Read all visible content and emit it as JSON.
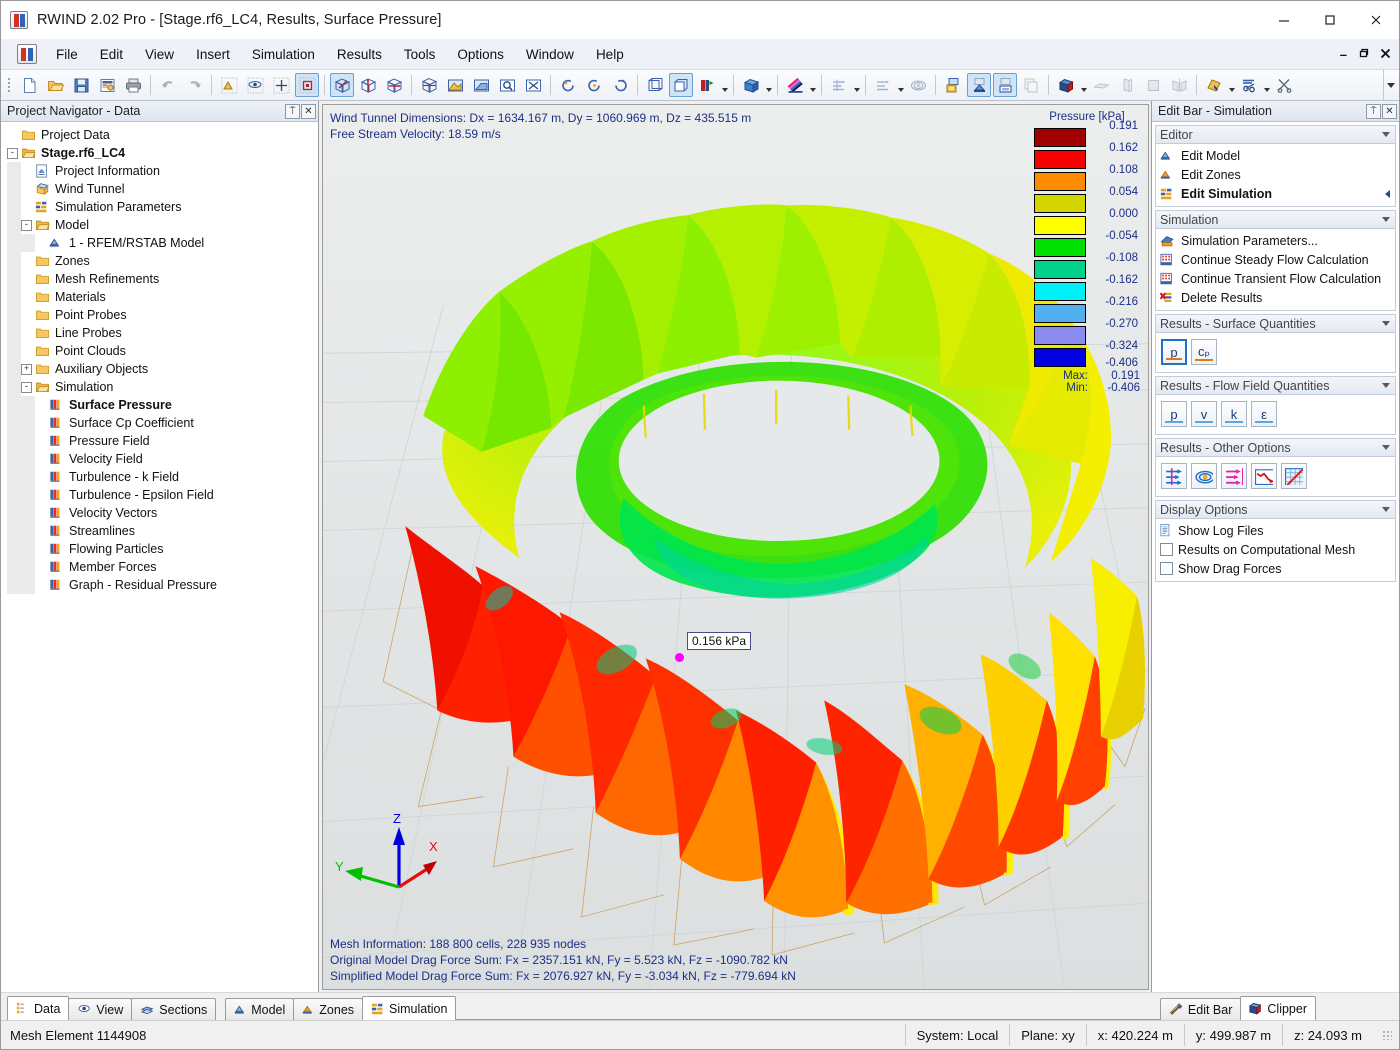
{
  "window": {
    "title": "RWIND 2.02 Pro - [Stage.rf6_LC4, Results, Surface Pressure]",
    "minimize": "—",
    "maximize": "□",
    "close": "✕",
    "mdi_minimize": "–",
    "mdi_restore": "❐",
    "mdi_close": "✕"
  },
  "menu": {
    "items": [
      {
        "label": "File"
      },
      {
        "label": "Edit"
      },
      {
        "label": "View"
      },
      {
        "label": "Insert"
      },
      {
        "label": "Simulation"
      },
      {
        "label": "Results"
      },
      {
        "label": "Tools"
      },
      {
        "label": "Options"
      },
      {
        "label": "Window"
      },
      {
        "label": "Help"
      }
    ]
  },
  "toolbar": {
    "buttons": [
      {
        "name": "new-file-icon",
        "active": false
      },
      {
        "name": "open-file-icon",
        "active": false
      },
      {
        "name": "save-icon",
        "active": false
      },
      {
        "name": "printout-report-icon",
        "active": false
      },
      {
        "name": "print-icon",
        "active": false
      },
      {
        "sep": true
      },
      {
        "name": "undo-icon",
        "active": false
      },
      {
        "name": "redo-icon",
        "active": false
      },
      {
        "sep": true
      },
      {
        "name": "snap-point-icon",
        "active": false
      },
      {
        "name": "object-snap-icon",
        "active": false
      },
      {
        "name": "grid-snap-icon",
        "active": false
      },
      {
        "name": "selection-box-icon",
        "active": true
      },
      {
        "sep": true
      },
      {
        "name": "view-iso-icon",
        "active": true
      },
      {
        "name": "view-rotate-icon",
        "active": false
      },
      {
        "name": "view-axes-icon",
        "active": false
      },
      {
        "sep": true
      },
      {
        "name": "view-cube-icon",
        "active": false
      },
      {
        "name": "render-shade-icon",
        "active": false
      },
      {
        "name": "zoom-window-icon",
        "active": false
      },
      {
        "name": "zoom-magnifier-icon",
        "active": false
      },
      {
        "name": "zoom-fit-icon",
        "active": false
      },
      {
        "sep": true
      },
      {
        "name": "rotate-left-icon",
        "active": false
      },
      {
        "name": "rotate-center-icon",
        "active": false
      },
      {
        "name": "rotate-right-icon",
        "active": false
      },
      {
        "sep": true
      },
      {
        "name": "wireframe-icon",
        "active": false
      },
      {
        "name": "solid-view-icon",
        "active": true
      },
      {
        "name": "move-axis-icon",
        "dropdown": true,
        "active": false
      },
      {
        "sep": true
      },
      {
        "name": "render-box-icon",
        "dropdown": true,
        "active": false
      },
      {
        "sep": true
      },
      {
        "name": "colors-icon",
        "dropdown": true,
        "active": false
      },
      {
        "sep": true
      },
      {
        "name": "flow-lines-icon",
        "dropdown": true,
        "active": false,
        "disabled": true
      },
      {
        "sep": true
      },
      {
        "name": "streamline-icon",
        "dropdown": true,
        "active": false,
        "disabled": true
      },
      {
        "name": "iso-surface-icon",
        "active": false,
        "disabled": true
      },
      {
        "sep": true
      },
      {
        "name": "zone-display-icon",
        "active": false
      },
      {
        "name": "model-display-icon",
        "active": true
      },
      {
        "name": "simulation-display-icon",
        "active": true
      },
      {
        "name": "copy-display-icon",
        "active": false,
        "disabled": true
      },
      {
        "sep": true
      },
      {
        "name": "clipper-box-icon",
        "dropdown": true,
        "active": false
      },
      {
        "name": "clip-plane-xy-icon",
        "active": false,
        "disabled": true
      },
      {
        "name": "clip-plane-yz-icon",
        "active": false,
        "disabled": true
      },
      {
        "name": "clip-plane-fill-icon",
        "active": false,
        "disabled": true
      },
      {
        "name": "clip-plane-mirror-icon",
        "active": false,
        "disabled": true
      },
      {
        "sep": true
      },
      {
        "name": "measure-icon",
        "dropdown": true,
        "active": false
      },
      {
        "name": "settings-tools-icon",
        "dropdown": true,
        "active": false
      },
      {
        "name": "cut-tools-icon",
        "active": false
      }
    ]
  },
  "navigator": {
    "title": "Project Navigator - Data",
    "pin_glyph": "⍑",
    "close_glyph": "✕",
    "tree": [
      {
        "label": "Project Data",
        "depth": 0,
        "expander": "",
        "icon": "folder",
        "bold": false
      },
      {
        "label": "Stage.rf6_LC4",
        "depth": 0,
        "expander": "-",
        "icon": "folder-open",
        "bold": true
      },
      {
        "label": "Project Information",
        "depth": 1,
        "expander": "",
        "icon": "project-info",
        "bold": false
      },
      {
        "label": "Wind Tunnel",
        "depth": 1,
        "expander": "",
        "icon": "wind-tunnel",
        "bold": false
      },
      {
        "label": "Simulation Parameters",
        "depth": 1,
        "expander": "",
        "icon": "sim-params",
        "bold": false
      },
      {
        "label": "Model",
        "depth": 1,
        "expander": "-",
        "icon": "folder-open",
        "bold": false
      },
      {
        "label": "1 - RFEM/RSTAB Model",
        "depth": 2,
        "expander": "",
        "icon": "model-node",
        "bold": false
      },
      {
        "label": "Zones",
        "depth": 1,
        "expander": "",
        "icon": "folder",
        "bold": false
      },
      {
        "label": "Mesh Refinements",
        "depth": 1,
        "expander": "",
        "icon": "folder",
        "bold": false
      },
      {
        "label": "Materials",
        "depth": 1,
        "expander": "",
        "icon": "folder",
        "bold": false
      },
      {
        "label": "Point Probes",
        "depth": 1,
        "expander": "",
        "icon": "folder",
        "bold": false
      },
      {
        "label": "Line Probes",
        "depth": 1,
        "expander": "",
        "icon": "folder",
        "bold": false
      },
      {
        "label": "Point Clouds",
        "depth": 1,
        "expander": "",
        "icon": "folder",
        "bold": false
      },
      {
        "label": "Auxiliary Objects",
        "depth": 1,
        "expander": "+",
        "icon": "folder",
        "bold": false
      },
      {
        "label": "Simulation",
        "depth": 1,
        "expander": "-",
        "icon": "folder-open",
        "bold": false
      },
      {
        "label": "Surface Pressure",
        "depth": 2,
        "expander": "",
        "icon": "result",
        "bold": true
      },
      {
        "label": "Surface Cp Coefficient",
        "depth": 2,
        "expander": "",
        "icon": "result",
        "bold": false
      },
      {
        "label": "Pressure Field",
        "depth": 2,
        "expander": "",
        "icon": "result",
        "bold": false
      },
      {
        "label": "Velocity Field",
        "depth": 2,
        "expander": "",
        "icon": "result",
        "bold": false
      },
      {
        "label": "Turbulence - k Field",
        "depth": 2,
        "expander": "",
        "icon": "result",
        "bold": false
      },
      {
        "label": "Turbulence - Epsilon Field",
        "depth": 2,
        "expander": "",
        "icon": "result",
        "bold": false
      },
      {
        "label": "Velocity Vectors",
        "depth": 2,
        "expander": "",
        "icon": "result",
        "bold": false
      },
      {
        "label": "Streamlines",
        "depth": 2,
        "expander": "",
        "icon": "result",
        "bold": false
      },
      {
        "label": "Flowing Particles",
        "depth": 2,
        "expander": "",
        "icon": "result",
        "bold": false
      },
      {
        "label": "Member Forces",
        "depth": 2,
        "expander": "",
        "icon": "result",
        "bold": false
      },
      {
        "label": "Graph - Residual Pressure",
        "depth": 2,
        "expander": "",
        "icon": "result",
        "bold": false
      }
    ]
  },
  "viewport": {
    "header_line1": "Wind Tunnel Dimensions: Dx = 1634.167 m, Dy = 1060.969 m, Dz = 435.515 m",
    "header_line2": "Free Stream Velocity: 18.59 m/s",
    "footer_line1": "Mesh Information: 188 800 cells, 228 935 nodes",
    "footer_line2": "Original Model Drag Force Sum: Fx = 2357.151 kN, Fy = 5.523 kN, Fz = -1090.782 kN",
    "footer_line3": "Simplified Model Drag Force Sum: Fx = 2076.927 kN, Fy = -3.034 kN, Fz = -779.694 kN",
    "tooltip_value": "0.156 kPa",
    "axes": {
      "x": "X",
      "y": "Y",
      "z": "Z",
      "x_color": "#e01010",
      "y_color": "#00c000",
      "z_color": "#0000e0"
    }
  },
  "legend": {
    "title": "Pressure [kPa]",
    "max_label": "Max:",
    "min_label": "Min:",
    "max_value": "0.191",
    "min_value": "-0.406",
    "swatches": [
      {
        "color": "#a00000",
        "above": "0.191",
        "below": "0.162"
      },
      {
        "color": "#f80000",
        "above": "0.162",
        "below": "0.108"
      },
      {
        "color": "#ff8c00",
        "above": "0.108",
        "below": "0.054"
      },
      {
        "color": "#d4d400",
        "above": "0.054",
        "below": "0.000"
      },
      {
        "color": "#ffff00",
        "above": "0.000",
        "below": "-0.054"
      },
      {
        "color": "#00e000",
        "above": "-0.054",
        "below": "-0.108"
      },
      {
        "color": "#00d28c",
        "above": "-0.108",
        "below": "-0.162"
      },
      {
        "color": "#00f0f8",
        "above": "-0.162",
        "below": "-0.216"
      },
      {
        "color": "#52b0f0",
        "above": "-0.216",
        "below": "-0.270"
      },
      {
        "color": "#8c8cf0",
        "above": "-0.270",
        "below": "-0.324"
      },
      {
        "color": "#0000e0",
        "above": "-0.324",
        "below": "-0.406"
      }
    ],
    "values": [
      "0.191",
      "0.162",
      "0.108",
      "0.054",
      "0.000",
      "-0.054",
      "-0.108",
      "-0.162",
      "-0.216",
      "-0.270",
      "-0.324",
      "-0.406"
    ]
  },
  "editbar": {
    "title": "Edit Bar - Simulation",
    "pin_glyph": "⍑",
    "close_glyph": "✕",
    "sections": [
      {
        "title": "Editor",
        "type": "list",
        "items": [
          {
            "label": "Edit Model",
            "icon": "edit-model",
            "bold": false,
            "arrow": false
          },
          {
            "label": "Edit Zones",
            "icon": "edit-zones",
            "bold": false,
            "arrow": false
          },
          {
            "label": "Edit Simulation",
            "icon": "edit-simulation",
            "bold": true,
            "arrow": true
          }
        ]
      },
      {
        "title": "Simulation",
        "type": "list",
        "items": [
          {
            "label": "Simulation Parameters...",
            "icon": "sim-parameters",
            "bold": false,
            "arrow": false
          },
          {
            "label": "Continue Steady Flow Calculation",
            "icon": "calc-steady",
            "bold": false,
            "arrow": false
          },
          {
            "label": "Continue Transient Flow Calculation",
            "icon": "calc-transient",
            "bold": false,
            "arrow": false
          },
          {
            "label": "Delete Results",
            "icon": "delete-results",
            "bold": false,
            "arrow": false
          }
        ]
      },
      {
        "title": "Results - Surface Quantities",
        "type": "buttons",
        "buttons": [
          {
            "label": "p",
            "name": "surface-pressure-button",
            "selected": true,
            "underline": "#e07818"
          },
          {
            "label": "cₚ",
            "name": "surface-cp-button",
            "selected": false,
            "underline": "#e07818"
          }
        ]
      },
      {
        "title": "Results - Flow Field Quantities",
        "type": "buttons",
        "buttons": [
          {
            "label": "p",
            "name": "flow-pressure-button",
            "selected": false,
            "underline": "#5aa8e0"
          },
          {
            "label": "v",
            "name": "flow-velocity-button",
            "selected": false,
            "underline": "#5aa8e0"
          },
          {
            "label": "k",
            "name": "flow-k-button",
            "selected": false,
            "underline": "#5aa8e0"
          },
          {
            "label": "ε",
            "name": "flow-epsilon-button",
            "selected": false,
            "underline": "#5aa8e0"
          }
        ]
      },
      {
        "title": "Results - Other Options",
        "type": "icon-buttons",
        "buttons": [
          {
            "name": "velocity-vectors-button"
          },
          {
            "name": "streamlines-button"
          },
          {
            "name": "flowing-particles-button"
          },
          {
            "name": "member-forces-button"
          },
          {
            "name": "residual-graph-button"
          }
        ]
      },
      {
        "title": "Display Options",
        "type": "checklist",
        "items": [
          {
            "label": "Show Log Files",
            "kind": "file",
            "checked": false
          },
          {
            "label": "Results on Computational Mesh",
            "kind": "check",
            "checked": false
          },
          {
            "label": "Show Drag Forces",
            "kind": "check",
            "checked": false
          }
        ]
      }
    ]
  },
  "tabs": {
    "left": [
      {
        "label": "Data",
        "icon": "data-tab-icon",
        "active": true
      },
      {
        "label": "View",
        "icon": "view-tab-icon",
        "active": false
      },
      {
        "label": "Sections",
        "icon": "sections-tab-icon",
        "active": false
      }
    ],
    "mid": [
      {
        "label": "Model",
        "icon": "model-tab-icon",
        "active": false
      },
      {
        "label": "Zones",
        "icon": "zones-tab-icon",
        "active": false
      },
      {
        "label": "Simulation",
        "icon": "simulation-tab-icon",
        "active": true
      }
    ],
    "right": [
      {
        "label": "Edit Bar",
        "icon": "edit-bar-tab-icon",
        "active": false
      },
      {
        "label": "Clipper",
        "icon": "clipper-tab-icon",
        "active": true
      }
    ]
  },
  "statusbar": {
    "message": "Mesh Element 1144908",
    "cells": [
      {
        "label": "System: Local",
        "name": "status-system"
      },
      {
        "label": "Plane: xy",
        "name": "status-plane"
      },
      {
        "label": "x:  420.224 m",
        "name": "status-x"
      },
      {
        "label": "y:  499.987 m",
        "name": "status-y"
      },
      {
        "label": "z:  24.093 m",
        "name": "status-z"
      }
    ]
  }
}
